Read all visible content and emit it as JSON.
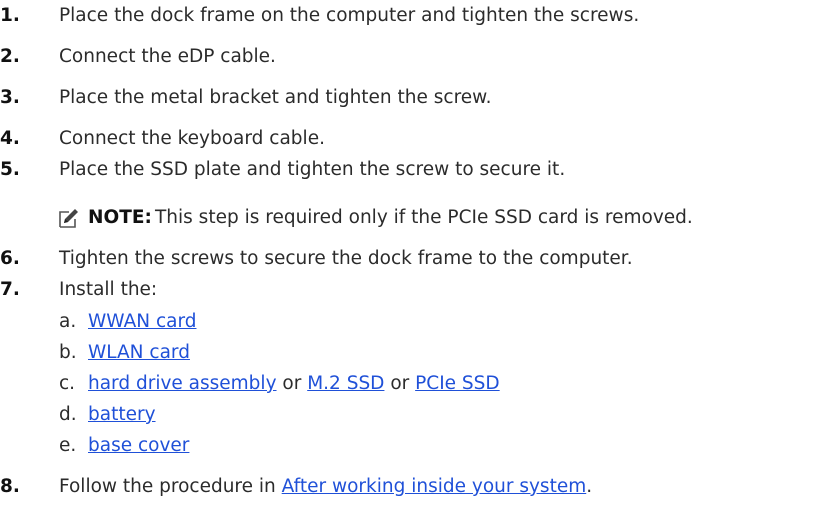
{
  "steps": [
    {
      "num": "1.",
      "text": "Place the dock frame on the computer and tighten the screws."
    },
    {
      "num": "2.",
      "text": "Connect the eDP cable."
    },
    {
      "num": "3.",
      "text": "Place the metal bracket and tighten the screw."
    },
    {
      "num": "4.",
      "text": "Connect the keyboard cable."
    },
    {
      "num": "5.",
      "text": "Place the SSD plate and tighten the screw to secure it."
    },
    {
      "num": "6.",
      "text": "Tighten the screws to secure the dock frame to the computer."
    },
    {
      "num": "7.",
      "text": "Install the:"
    },
    {
      "num": "8.",
      "text": "Follow the procedure in ",
      "link": "After working inside your system",
      "after": "."
    }
  ],
  "note": {
    "icon": "pencil-note-icon",
    "label": "NOTE:",
    "text": "This step is required only if the PCIe SSD card is removed."
  },
  "install_items": [
    {
      "letter": "a.",
      "link": "WWAN card"
    },
    {
      "letter": "b.",
      "link": "WLAN card"
    },
    {
      "letter": "c.",
      "link": "hard drive assembly",
      "or1": " or ",
      "link2": "M.2 SSD",
      "or2": " or ",
      "link3": "PCIe SSD"
    },
    {
      "letter": "d.",
      "link": "battery"
    },
    {
      "letter": "e.",
      "link": "base cover"
    }
  ],
  "colors": {
    "link": "#1f50d8",
    "text": "#2b2b2b"
  }
}
